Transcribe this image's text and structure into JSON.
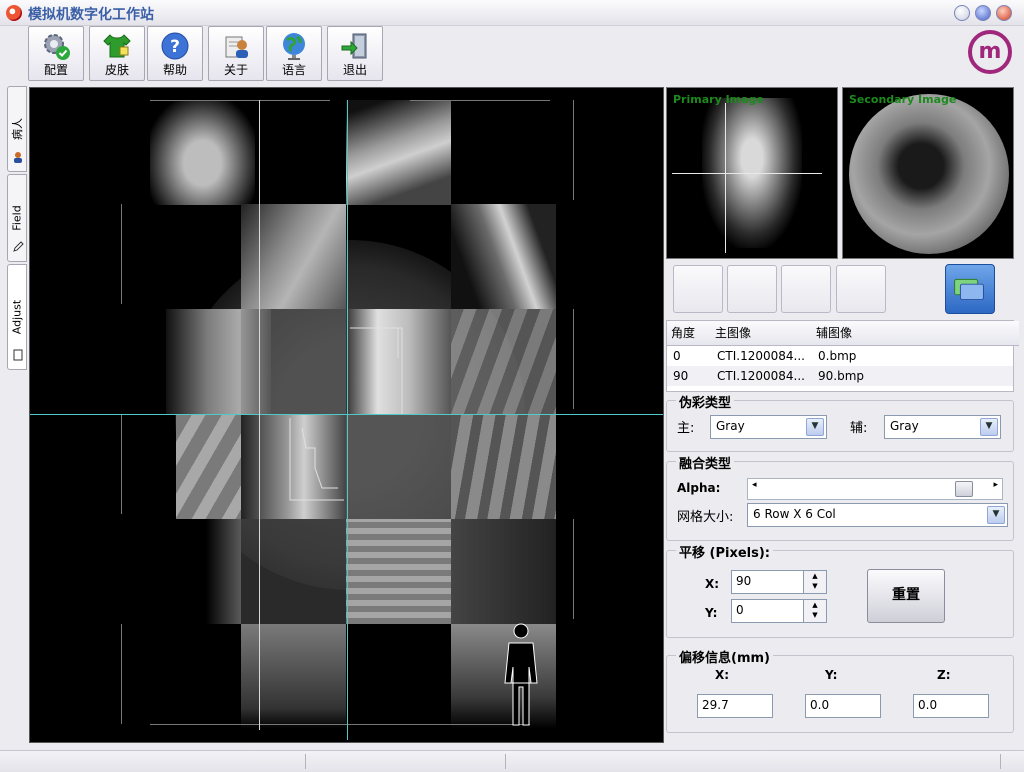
{
  "window": {
    "title": "模拟机数字化工作站"
  },
  "toolbar": [
    {
      "id": "config",
      "label": "配置",
      "icon": "gear-check-icon"
    },
    {
      "id": "skin",
      "label": "皮肤",
      "icon": "shirt-icon"
    },
    {
      "id": "help",
      "label": "帮助",
      "icon": "help-icon"
    },
    {
      "id": "about",
      "label": "关于",
      "icon": "about-user-icon"
    },
    {
      "id": "language",
      "label": "语言",
      "icon": "globe-icon"
    },
    {
      "id": "exit",
      "label": "退出",
      "icon": "exit-door-icon"
    }
  ],
  "brand": {
    "logo_text": "m",
    "accent": "#a0287c"
  },
  "side_tabs": [
    {
      "id": "patient",
      "label": "病人",
      "icon": "person-icon"
    },
    {
      "id": "field",
      "label": "Field",
      "icon": "pencil-icon"
    },
    {
      "id": "adjust",
      "label": "Adjust",
      "icon": "page-icon",
      "active": true
    }
  ],
  "thumbnails": {
    "primary_caption": "Primary Image",
    "secondary_caption": "Secondary Image"
  },
  "table": {
    "headers": [
      "角度",
      "主图像",
      "辅图像"
    ],
    "rows": [
      [
        "0",
        "CTI.1200084...",
        "0.bmp"
      ],
      [
        "90",
        "CTI.1200084...",
        "90.bmp"
      ]
    ]
  },
  "pseudocolor": {
    "title": "伪彩类型",
    "primary_label": "主:",
    "primary_value": "Gray",
    "secondary_label": "辅:",
    "secondary_value": "Gray"
  },
  "fusion": {
    "title": "融合类型",
    "alpha_label": "Alpha:",
    "alpha_value": 0.92,
    "grid_label": "网格大小:",
    "grid_value": "6 Row X 6 Col"
  },
  "translate": {
    "title": "平移 (Pixels):",
    "x_label": "X:",
    "x_value": "90",
    "y_label": "Y:",
    "y_value": "0",
    "reset_label": "重置"
  },
  "offset": {
    "title": "偏移信息(mm)",
    "x_label": "X:",
    "y_label": "Y:",
    "z_label": "Z:",
    "x_value": "29.7",
    "y_value": "0.0",
    "z_value": "0.0"
  },
  "colors": {
    "crosshair": "#4fc9c9",
    "caption_green": "#1c8a1c",
    "title_blue": "#3a5fa6"
  }
}
